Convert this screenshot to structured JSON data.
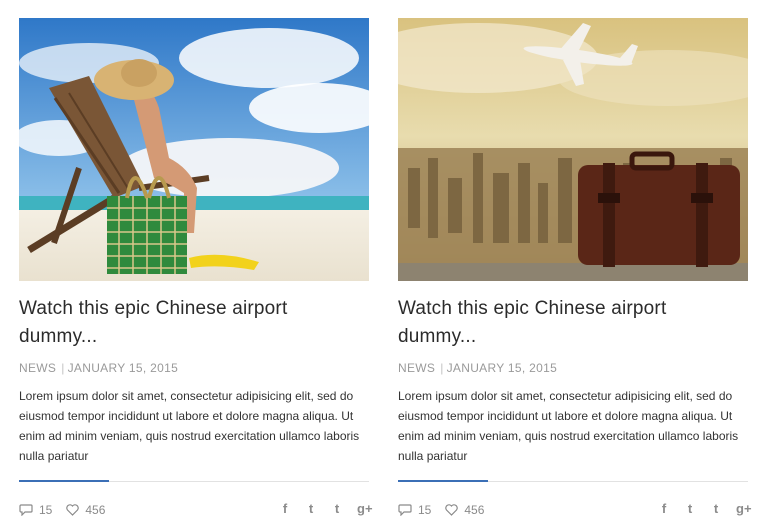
{
  "posts": [
    {
      "image": "beach-chair-straw-hat-bag",
      "title_line1": "Watch this epic Chinese airport",
      "title_line2": "dummy...",
      "category": "NEWS",
      "date": "JANUARY 15, 2015",
      "excerpt": "Lorem ipsum dolor sit amet, consectetur adipisicing elit, sed do eiusmod tempor incididunt ut labore et dolore magna aliqua. Ut enim ad minim veniam, quis nostrud exercitation ullamco laboris nulla pariatur",
      "comments": "15",
      "likes": "456"
    },
    {
      "image": "airplane-city-suitcase",
      "title_line1": "Watch this epic Chinese airport",
      "title_line2": "dummy...",
      "category": "NEWS",
      "date": "JANUARY 15, 2015",
      "excerpt": "Lorem ipsum dolor sit amet, consectetur adipisicing elit, sed do eiusmod tempor incididunt ut labore et dolore magna aliqua. Ut enim ad minim veniam, quis nostrud exercitation ullamco laboris nulla pariatur",
      "comments": "15",
      "likes": "456"
    }
  ],
  "share": {
    "facebook": "f",
    "twitter": "t",
    "tumblr": "t",
    "googleplus": "g+"
  },
  "colors": {
    "accent": "#3b6fb6",
    "meta": "#9a9a9a"
  },
  "separator": "|"
}
